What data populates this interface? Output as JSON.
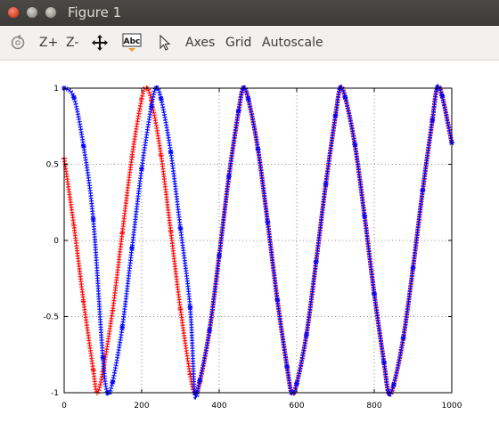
{
  "window": {
    "title": "Figure 1"
  },
  "toolbar": {
    "items": [
      {
        "name": "rotate-icon"
      },
      {
        "label": "Z+"
      },
      {
        "label": "Z-"
      },
      {
        "name": "pan-icon"
      },
      {
        "name": "text-abc-icon",
        "text": "Abc"
      },
      {
        "name": "pointer-icon"
      },
      {
        "label": "Axes"
      },
      {
        "label": "Grid"
      },
      {
        "label": "Autoscale"
      }
    ]
  },
  "chart_data": {
    "type": "line",
    "title": "",
    "xlabel": "",
    "ylabel": "",
    "xlim": [
      0,
      1000
    ],
    "ylim": [
      -1,
      1
    ],
    "xticks": [
      "0",
      "200",
      "400",
      "600",
      "800",
      "1000"
    ],
    "yticks": [
      "1",
      "0.5",
      "0",
      "-0.5",
      "-1"
    ],
    "grid": true,
    "series": [
      {
        "color": "#ff0000",
        "marker": "+",
        "x": [
          0,
          25,
          50,
          75,
          85,
          100,
          125,
          150,
          175,
          200,
          212,
          225,
          250,
          275,
          300,
          325,
          337,
          350,
          375,
          400,
          425,
          450,
          462,
          475,
          500,
          525,
          550,
          575,
          587,
          600,
          625,
          650,
          675,
          700,
          712,
          725,
          750,
          775,
          800,
          825,
          837,
          850,
          875,
          900,
          925,
          950,
          962,
          975,
          1000
        ],
        "y": [
          0.54,
          0.1,
          -0.4,
          -0.85,
          -1.0,
          -0.86,
          -0.46,
          0.05,
          0.55,
          0.93,
          1.0,
          0.92,
          0.56,
          0.06,
          -0.45,
          -0.88,
          -1.0,
          -0.93,
          -0.59,
          -0.1,
          0.42,
          0.85,
          1.0,
          0.93,
          0.6,
          0.12,
          -0.39,
          -0.83,
          -1.0,
          -0.94,
          -0.62,
          -0.14,
          0.37,
          0.82,
          1.0,
          0.94,
          0.63,
          0.16,
          -0.35,
          -0.8,
          -1.0,
          -0.95,
          -0.64,
          -0.18,
          0.33,
          0.79,
          1.0,
          0.95,
          0.64
        ]
      },
      {
        "color": "#0000ff",
        "marker": "*",
        "x": [
          0,
          25,
          50,
          75,
          100,
          112,
          125,
          150,
          175,
          200,
          225,
          237,
          250,
          275,
          300,
          325,
          337,
          350,
          375,
          400,
          425,
          450,
          462,
          475,
          500,
          525,
          550,
          575,
          587,
          600,
          625,
          650,
          675,
          700,
          712,
          725,
          750,
          775,
          800,
          825,
          837,
          850,
          875,
          900,
          925,
          950,
          962,
          975,
          1000
        ],
        "y": [
          1.0,
          0.94,
          0.62,
          0.14,
          -0.77,
          -1.0,
          -0.93,
          -0.57,
          -0.05,
          0.47,
          0.88,
          1.0,
          0.93,
          0.58,
          0.08,
          -0.44,
          -1.0,
          -0.92,
          -0.59,
          -0.1,
          0.42,
          0.85,
          1.0,
          0.93,
          0.6,
          0.12,
          -0.39,
          -0.83,
          -1.0,
          -0.94,
          -0.62,
          -0.14,
          0.37,
          0.82,
          1.0,
          0.94,
          0.63,
          0.16,
          -0.35,
          -0.8,
          -1.0,
          -0.95,
          -0.64,
          -0.18,
          0.33,
          0.79,
          1.0,
          0.95,
          0.64
        ]
      }
    ]
  }
}
